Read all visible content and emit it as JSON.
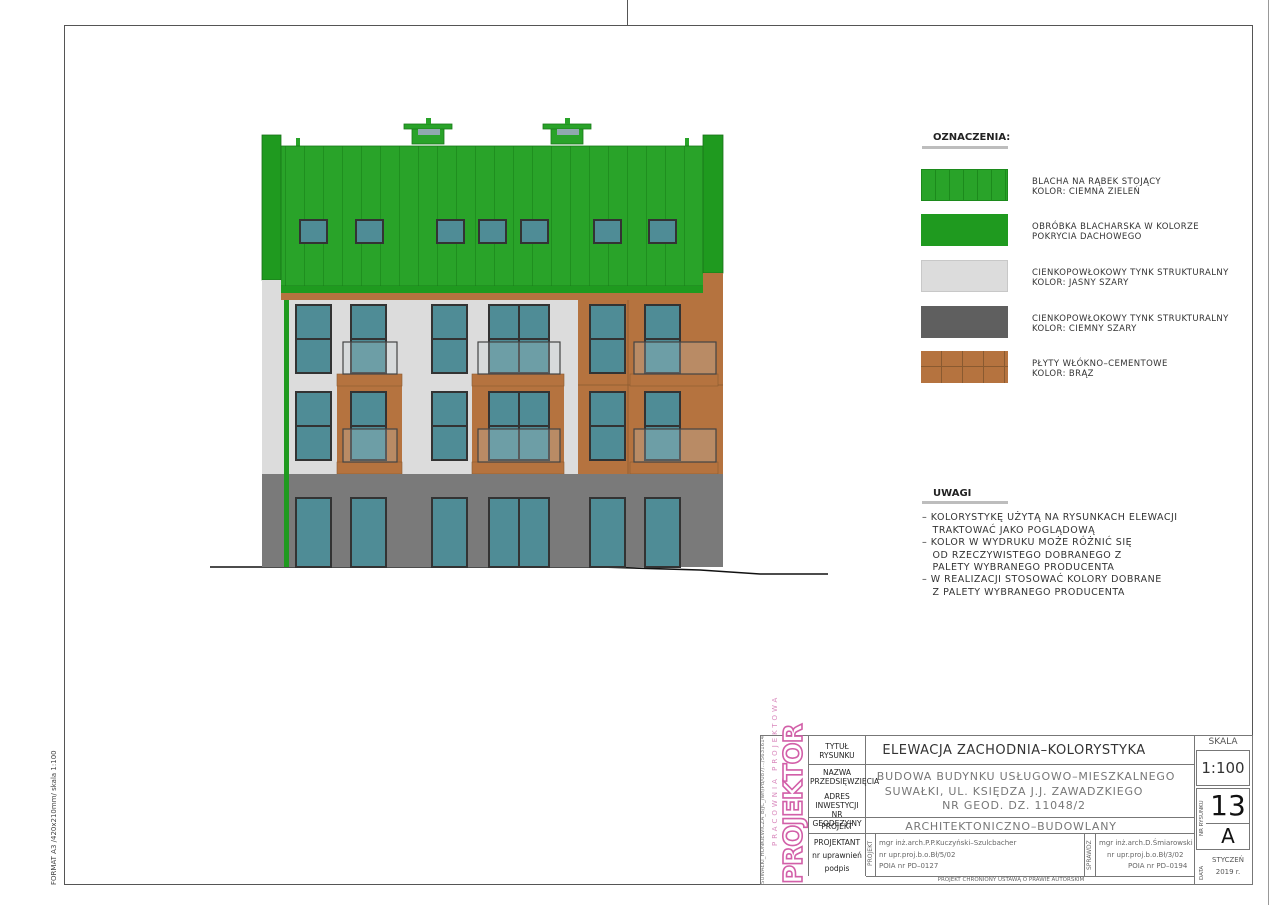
{
  "sheet": {
    "format_note": "FORMAT A3 /420x210mm/ skala 1:100",
    "side_code": "SUWAŁKI_HONKIEWICZA_B/JC_/wh/Pd/087/.../5631614"
  },
  "legend": {
    "title": "OZNACZENIA:",
    "items": [
      {
        "line1": "BLACHA NA RĄBEK STOJĄCY",
        "line2": "KOLOR: CIEMNA ZIELEŃ",
        "color": "#29a329",
        "pattern": "seams"
      },
      {
        "line1": "OBRÓBKA BLACHARSKA W KOLORZE",
        "line2": "POKRYCIA DACHOWEGO",
        "color": "#1f9a1f",
        "pattern": "solid"
      },
      {
        "line1": "CIENKOPOWŁOKOWY TYNK STRUKTURALNY",
        "line2": "KOLOR: JASNY SZARY",
        "color": "#dcdcdc",
        "pattern": "solid"
      },
      {
        "line1": "CIENKOPOWŁOKOWY TYNK STRUKTURALNY",
        "line2": "KOLOR: CIEMNY SZARY",
        "color": "#5f5f5f",
        "pattern": "solid"
      },
      {
        "line1": "PŁYTY WŁÓKNO–CEMENTOWE",
        "line2": "KOLOR: BRĄZ",
        "color": "#b5733f",
        "pattern": "panels"
      }
    ]
  },
  "notes": {
    "title": "UWAGI",
    "lines": [
      "– KOLORYSTYKĘ UŻYTĄ NA RYSUNKACH ELEWACJI",
      "   TRAKTOWAĆ JAKO POGLĄDOWĄ",
      "– KOLOR W WYDRUKU MOŻE RÓŻNIĆ SIĘ",
      "   OD RZECZYWISTEGO DOBRANEGO Z",
      "   PALETY WYBRANEGO PRODUCENTA",
      "– W REALIZACJI STOSOWAĆ KOLORY DOBRANE",
      "   Z PALETY WYBRANEGO PRODUCENTA"
    ]
  },
  "title_block": {
    "logo_text": "PROJEKTOR",
    "logo_sub": "PRACOWNIA PROJEKTOWA",
    "label_title": "TYTUŁ RYSUNKU",
    "label_investment": "NAZWA PRZEDSIĘWZIĘCIA",
    "label_address": "ADRES INWESTYCJI NR GEODEZYJNY",
    "label_project": "PROJEKT",
    "label_designer": "PROJEKTANT",
    "label_license": "nr uprawnień",
    "label_signature": "podpis",
    "drawing_title": "ELEWACJA ZACHODNIA–KOLORYSTYKA",
    "investment_line1": "BUDOWA BUDYNKU USŁUGOWO–MIESZKALNEGO",
    "investment_line2": "SUWAŁKI, UL. KSIĘDZA J.J. ZAWADZKIEGO",
    "investment_line3": "NR GEOD. DZ. 11048/2",
    "project_type": "ARCHITEKTONICZNO–BUDOWLANY",
    "designer_name": "mgr inż.arch.P.P.Kuczyński–Szulcbacher",
    "designer_license": "nr upr.proj.b.o.Bł/5/02",
    "designer_poia": "POIA nr PD–0127",
    "checker_name": "mgr inż.arch.D.Śmiarowski",
    "checker_license": "nr upr.proj.b.o.Bł/3/02",
    "checker_poia": "POIA nr PD–0194",
    "side_projekt": "PROJEKT",
    "side_sprawdz": "SPRAWDZ",
    "scale_label": "SKALA",
    "scale_value": "1:100",
    "drawing_no_label": "NR RYSUNKU",
    "drawing_no": "13",
    "drawing_letter": "A",
    "date_label": "DATA",
    "date_month": "STYCZEŃ",
    "date_year": "2019 r.",
    "copyright": "PROJEKT CHRONIONY USTAWĄ O PRAWIE AUTORSKIM"
  },
  "colors": {
    "roof": "#29a329",
    "roof_dark": "#1f9a1f",
    "plaster_light": "#dcdcdc",
    "plaster_dark": "#7a7a7a",
    "fibre_brown": "#b5733f",
    "glass": "#4f8c96"
  }
}
